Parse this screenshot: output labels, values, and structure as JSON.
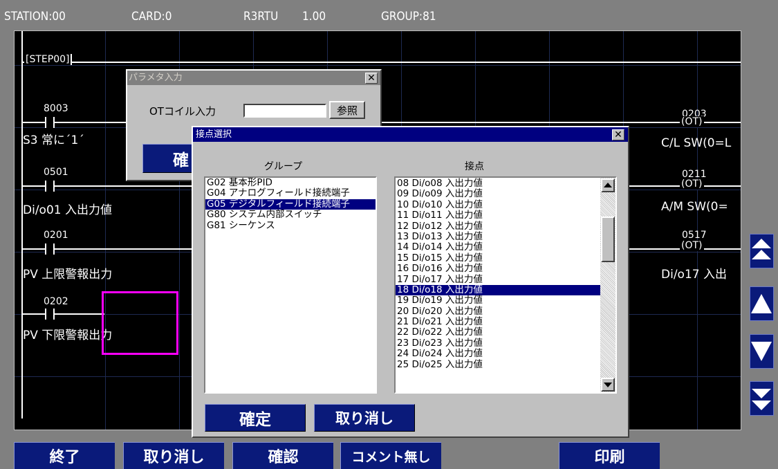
{
  "header": {
    "station": "STATION:00",
    "card": "CARD:0",
    "model": "R3RTU",
    "version": "1.00",
    "group": "GROUP:81"
  },
  "ladder": {
    "step_label": "[STEP00]",
    "rungs": [
      {
        "address": "8003",
        "comment": "S3 常に´1´",
        "coil_address": "0203",
        "coil_type": "OT",
        "coil_comment": "C/L SW(0=L"
      },
      {
        "address": "0501",
        "comment": "Di/o01 入出力値",
        "coil_address": "0211",
        "coil_type": "OT",
        "coil_comment": "A/M SW(0="
      },
      {
        "address": "0201",
        "comment": "PV 上限警報出力",
        "coil_address": "0517",
        "coil_type": "OT",
        "coil_comment": "Di/o17 入出"
      },
      {
        "address": "0202",
        "comment": "PV 下限警報出力"
      }
    ]
  },
  "param_dialog": {
    "title": "パラメタ入力",
    "field_label": "OTコイル入力",
    "field_value": "",
    "browse_label": "参照",
    "confirm_label": "確"
  },
  "contact_dialog": {
    "title": "接点選択",
    "group_header": "グループ",
    "contact_header": "接点",
    "groups": [
      {
        "label": "G02 基本形PID",
        "selected": false
      },
      {
        "label": "G04 アナログフィールド接続端子",
        "selected": false
      },
      {
        "label": "G05 デジタルフィールド接続端子",
        "selected": true
      },
      {
        "label": "G80 システム内部スイッチ",
        "selected": false
      },
      {
        "label": "G81 シーケンス",
        "selected": false
      }
    ],
    "contacts": [
      {
        "label": "08 Di/o08 入出力値",
        "selected": false
      },
      {
        "label": "09 Di/o09 入出力値",
        "selected": false
      },
      {
        "label": "10 Di/o10 入出力値",
        "selected": false
      },
      {
        "label": "11 Di/o11 入出力値",
        "selected": false
      },
      {
        "label": "12 Di/o12 入出力値",
        "selected": false
      },
      {
        "label": "13 Di/o13 入出力値",
        "selected": false
      },
      {
        "label": "14 Di/o14 入出力値",
        "selected": false
      },
      {
        "label": "15 Di/o15 入出力値",
        "selected": false
      },
      {
        "label": "16 Di/o16 入出力値",
        "selected": false
      },
      {
        "label": "17 Di/o17 入出力値",
        "selected": false
      },
      {
        "label": "18 Di/o18 入出力値",
        "selected": true
      },
      {
        "label": "19 Di/o19 入出力値",
        "selected": false
      },
      {
        "label": "20 Di/o20 入出力値",
        "selected": false
      },
      {
        "label": "21 Di/o21 入出力値",
        "selected": false
      },
      {
        "label": "22 Di/o22 入出力値",
        "selected": false
      },
      {
        "label": "23 Di/o23 入出力値",
        "selected": false
      },
      {
        "label": "24 Di/o24 入出力値",
        "selected": false
      },
      {
        "label": "25 Di/o25 入出力値",
        "selected": false
      }
    ],
    "confirm_label": "確定",
    "cancel_label": "取り消し"
  },
  "bottom_bar": {
    "exit_label": "終了",
    "cancel_label": "取り消し",
    "confirm_label": "確認",
    "no_comment_label": "コメント無し",
    "print_label": "印刷"
  },
  "colors": {
    "ladder_bg": "#000000",
    "button_blue": "#0a1a7a",
    "selection": "#000080",
    "cursor": "#ff00ff"
  },
  "side_buttons": [
    "page-up-icon",
    "up-icon",
    "down-icon",
    "page-down-icon"
  ]
}
